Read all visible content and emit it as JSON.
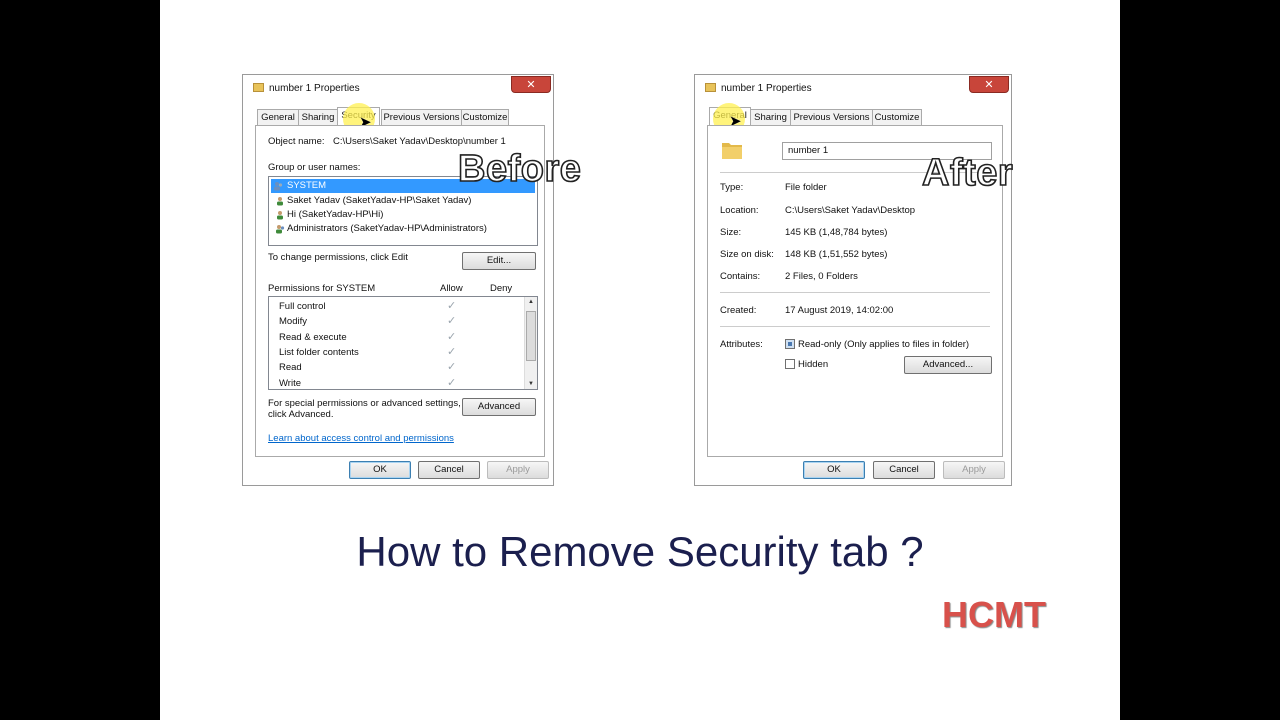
{
  "before_dialog": {
    "title": "number 1 Properties",
    "close": "✕",
    "tabs": [
      "General",
      "Sharing",
      "Security",
      "Previous Versions",
      "Customize"
    ],
    "object_name_label": "Object name:",
    "object_name_value": "C:\\Users\\Saket Yadav\\Desktop\\number 1",
    "group_label": "Group or user names:",
    "users": [
      "SYSTEM",
      "Saket Yadav (SaketYadav-HP\\Saket Yadav)",
      "Hi (SaketYadav-HP\\Hi)",
      "Administrators (SaketYadav-HP\\Administrators)"
    ],
    "change_text": "To change permissions, click Edit",
    "edit_button": "Edit...",
    "permissions_label": "Permissions for SYSTEM",
    "allow_header": "Allow",
    "deny_header": "Deny",
    "permissions": [
      "Full control",
      "Modify",
      "Read & execute",
      "List folder contents",
      "Read",
      "Write"
    ],
    "special_line1": "For special permissions or advanced settings,",
    "special_line2": "click Advanced.",
    "advanced_button": "Advanced",
    "learn_link": "Learn about access control and permissions",
    "ok": "OK",
    "cancel": "Cancel",
    "apply": "Apply"
  },
  "after_dialog": {
    "title": "number 1 Properties",
    "close": "✕",
    "tabs": [
      "General",
      "Sharing",
      "Previous Versions",
      "Customize"
    ],
    "folder_name": "number 1",
    "type_label": "Type:",
    "type_value": "File folder",
    "location_label": "Location:",
    "location_value": "C:\\Users\\Saket Yadav\\Desktop",
    "size_label": "Size:",
    "size_value": "145 KB (1,48,784 bytes)",
    "size_on_disk_label": "Size on disk:",
    "size_on_disk_value": "148 KB (1,51,552 bytes)",
    "contains_label": "Contains:",
    "contains_value": "2 Files, 0 Folders",
    "created_label": "Created:",
    "created_value": "17 August 2019, 14:02:00",
    "attributes_label": "Attributes:",
    "readonly_label": "Read-only (Only applies to files in folder)",
    "hidden_label": "Hidden",
    "advanced_button": "Advanced...",
    "ok": "OK",
    "cancel": "Cancel",
    "apply": "Apply"
  },
  "overlay": {
    "before": "Before",
    "after": "After",
    "headline": "How to Remove Security tab ?",
    "brand": "HCMT"
  },
  "colors": {
    "headline": "#1b1f4e",
    "brand": "#d8514b",
    "selection": "#3399ff",
    "close_button": "#c8453a"
  }
}
